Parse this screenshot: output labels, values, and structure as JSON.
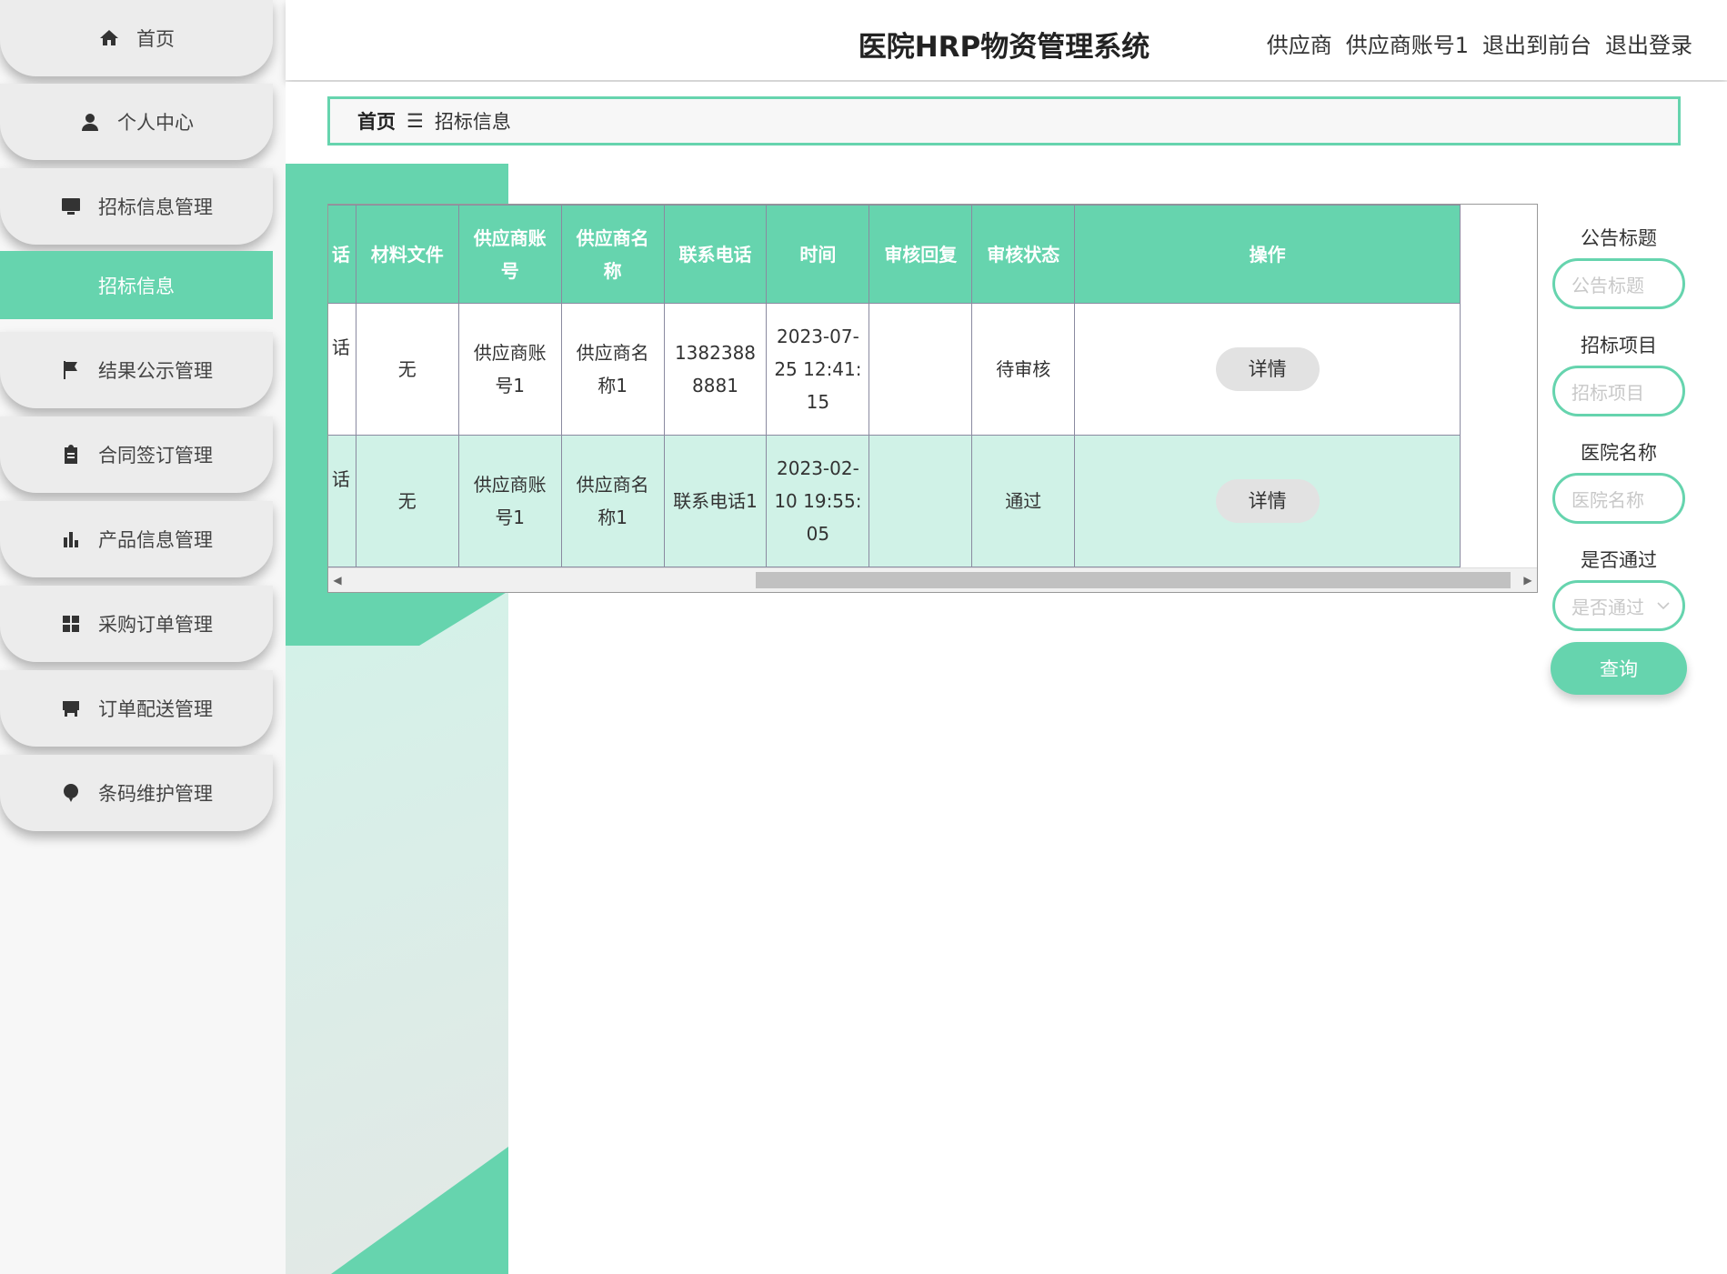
{
  "app": {
    "title": "医院HRP物资管理系统"
  },
  "header": {
    "role": "供应商",
    "account": "供应商账号1",
    "front_link": "退出到前台",
    "logout_link": "退出登录"
  },
  "sidebar": {
    "items": [
      {
        "label": "首页",
        "icon": "home-icon"
      },
      {
        "label": "个人中心",
        "icon": "person-icon"
      },
      {
        "label": "招标信息管理",
        "icon": "monitor-icon"
      },
      {
        "label": "结果公示管理",
        "icon": "flag-icon"
      },
      {
        "label": "合同签订管理",
        "icon": "clipboard-icon"
      },
      {
        "label": "产品信息管理",
        "icon": "bar-chart-icon"
      },
      {
        "label": "采购订单管理",
        "icon": "grid-icon"
      },
      {
        "label": "订单配送管理",
        "icon": "store-icon"
      },
      {
        "label": "条码维护管理",
        "icon": "balloon-icon"
      }
    ],
    "active_sub": "招标信息"
  },
  "breadcrumb": {
    "home": "首页",
    "sep": "☰",
    "current": "招标信息"
  },
  "table": {
    "headers": [
      "话",
      "材料文件",
      "供应商账号",
      "供应商名称",
      "联系电话",
      "时间",
      "审核回复",
      "审核状态",
      "操作"
    ],
    "rows": [
      [
        "话",
        "无",
        "供应商账号1",
        "供应商名称1",
        "13823888881",
        "2023-07-25 12:41:15",
        "",
        "待审核"
      ],
      [
        "话",
        "无",
        "供应商账号1",
        "供应商名称1",
        "联系电话1",
        "2023-02-10 19:55:05",
        "",
        "通过"
      ]
    ],
    "action_label": "详情"
  },
  "search": {
    "title_label": "公告标题",
    "title_placeholder": "公告标题",
    "project_label": "招标项目",
    "project_placeholder": "招标项目",
    "hospital_label": "医院名称",
    "hospital_placeholder": "医院名称",
    "pass_label": "是否通过",
    "pass_placeholder": "是否通过",
    "query_button": "查询"
  },
  "colors": {
    "accent": "#66d4ae",
    "accent_light": "#d0f2e7"
  }
}
